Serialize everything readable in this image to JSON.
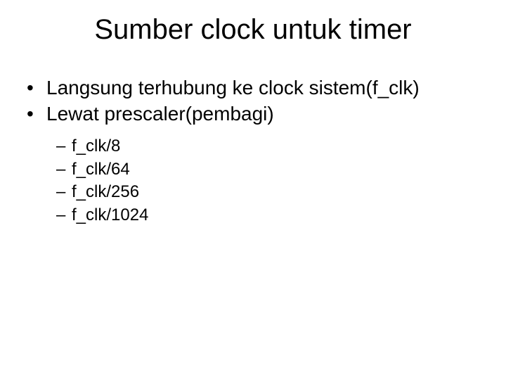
{
  "title": "Sumber clock untuk timer",
  "bullets": [
    "Langsung terhubung ke clock sistem(f_clk)",
    "Lewat prescaler(pembagi)"
  ],
  "subbullets": [
    "f_clk/8",
    "f_clk/64",
    "f_clk/256",
    "f_clk/1024"
  ]
}
